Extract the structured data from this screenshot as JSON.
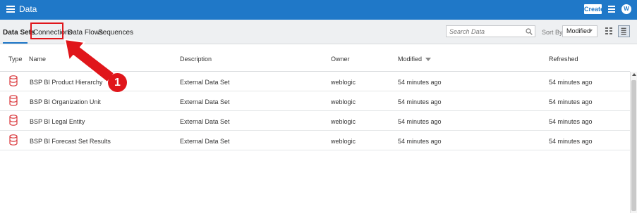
{
  "header": {
    "title": "Data",
    "create_label": "Create",
    "avatar_initial": "W",
    "menu_icon": "hamburger-icon",
    "list_icon": "list-icon"
  },
  "tabs": [
    {
      "label": "Data Sets",
      "active": true
    },
    {
      "label": "Connections",
      "active": false
    },
    {
      "label": "Data Flows",
      "active": false
    },
    {
      "label": "Sequences",
      "active": false
    }
  ],
  "search": {
    "placeholder": "Search Data",
    "value": ""
  },
  "sort": {
    "label": "Sort By",
    "selected": "Modified"
  },
  "table": {
    "columns": [
      "Type",
      "Name",
      "Description",
      "Owner",
      "Modified",
      "Refreshed"
    ],
    "rows": [
      {
        "name": "BSP BI Product Hierarchy",
        "description": "External Data Set",
        "owner": "weblogic",
        "modified": "54 minutes ago",
        "refreshed": "54 minutes ago"
      },
      {
        "name": "BSP BI Organization Unit",
        "description": "External Data Set",
        "owner": "weblogic",
        "modified": "54 minutes ago",
        "refreshed": "54 minutes ago"
      },
      {
        "name": "BSP BI Legal Entity",
        "description": "External Data Set",
        "owner": "weblogic",
        "modified": "54 minutes ago",
        "refreshed": "54 minutes ago"
      },
      {
        "name": "BSP BI Forecast Set Results",
        "description": "External Data Set",
        "owner": "weblogic",
        "modified": "54 minutes ago",
        "refreshed": "54 minutes ago"
      }
    ]
  },
  "annotation": {
    "step_number": "1",
    "color": "#e0161b"
  },
  "colors": {
    "brand": "#1f78c8",
    "highlight": "#e0161b"
  }
}
